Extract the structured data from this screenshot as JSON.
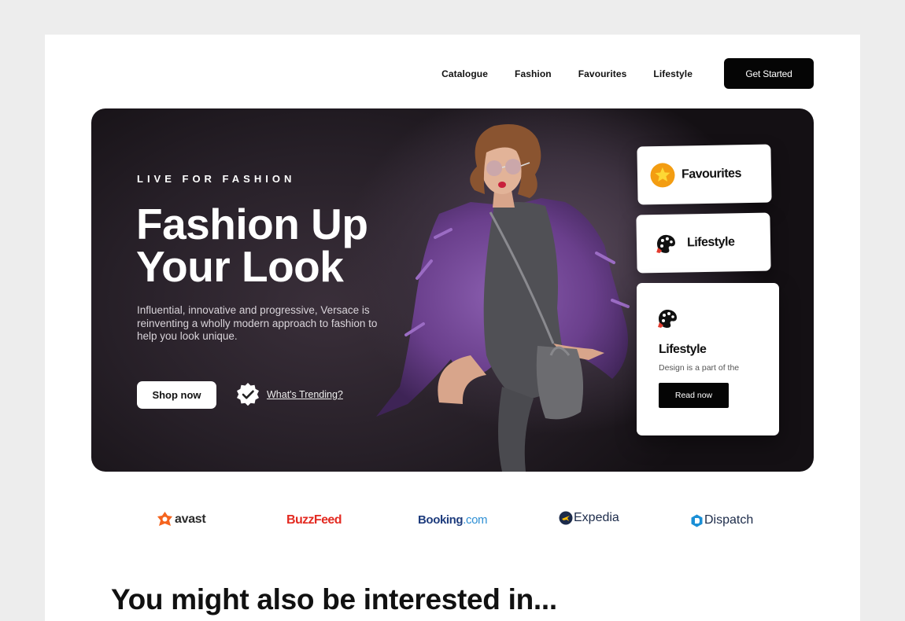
{
  "nav": {
    "items": [
      "Catalogue",
      "Fashion",
      "Favourites",
      "Lifestyle"
    ],
    "cta_label": "Get Started"
  },
  "hero": {
    "eyebrow": "LIVE FOR FASHION",
    "headline_line1": "Fashion Up",
    "headline_line2": "Your Look",
    "description": "Influential, innovative and progressive, Versace is reinventing a wholly modern approach to fashion to help you look unique.",
    "shop_label": "Shop now",
    "trend_label": "What's Trending?"
  },
  "cards": {
    "favourites_title": "Favourites",
    "lifestyle_title": "Lifestyle",
    "feature": {
      "title": "Lifestyle",
      "subtitle": "Design is a part of the",
      "button": "Read now"
    }
  },
  "logos": {
    "avast": "avast",
    "buzzfeed": "BuzzFeed",
    "booking_1": "Booking",
    "booking_2": ".com",
    "expedia": "Expedia",
    "dispatch": "Dispatch"
  },
  "section": {
    "title": "You might also be interested in..."
  },
  "colors": {
    "accent_dark": "#050505",
    "hero_bg": "#241d26",
    "buzzfeed": "#e32a21",
    "booking_blue": "#1e3c7d",
    "avast_orange": "#f5641e"
  },
  "icons": [
    "star-icon",
    "palette-icon",
    "verified-badge-icon"
  ]
}
